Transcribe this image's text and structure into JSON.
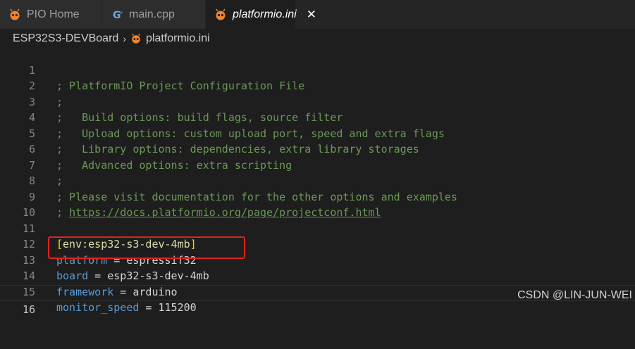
{
  "tabs": [
    {
      "label": "PIO Home",
      "icon": "platformio-icon",
      "active": false
    },
    {
      "label": "main.cpp",
      "icon": "cpp-file-icon",
      "active": false
    },
    {
      "label": "platformio.ini",
      "icon": "platformio-icon",
      "active": true,
      "close": "✕"
    }
  ],
  "breadcrumb": {
    "root": "ESP32S3-DEVBoard",
    "separator": "›",
    "file": "platformio.ini"
  },
  "editor": {
    "lines": [
      {
        "number": "1",
        "text": "; PlatformIO Project Configuration File"
      },
      {
        "number": "2",
        "text": ";"
      },
      {
        "number": "3",
        "text": ";   Build options: build flags, source filter"
      },
      {
        "number": "4",
        "text": ";   Upload options: custom upload port, speed and extra flags"
      },
      {
        "number": "5",
        "text": ";   Library options: dependencies, extra library storages"
      },
      {
        "number": "6",
        "text": ";   Advanced options: extra scripting"
      },
      {
        "number": "7",
        "text": ";"
      },
      {
        "number": "8",
        "text": "; Please visit documentation for the other options and examples"
      },
      {
        "number": "9",
        "prefix": "; ",
        "link": "https://docs.platformio.org/page/projectconf.html"
      },
      {
        "number": "10",
        "text": ""
      },
      {
        "number": "11",
        "section": "env:esp32-s3-dev-4mb"
      },
      {
        "number": "12",
        "key": "platform",
        "value": "espressif32"
      },
      {
        "number": "13",
        "key": "board",
        "value": "esp32-s3-dev-4mb"
      },
      {
        "number": "14",
        "key": "framework",
        "value": "arduino"
      },
      {
        "number": "15",
        "key": "monitor_speed",
        "value": "115200"
      },
      {
        "number": "16",
        "text": ""
      }
    ],
    "current_line": "16"
  },
  "watermark": "CSDN @LIN-JUN-WEI",
  "colors": {
    "background": "#1e1e1e",
    "comment": "#6a9955",
    "key": "#569cd6",
    "highlight_border": "#e3201b",
    "platformio_orange": "#f5822a"
  }
}
